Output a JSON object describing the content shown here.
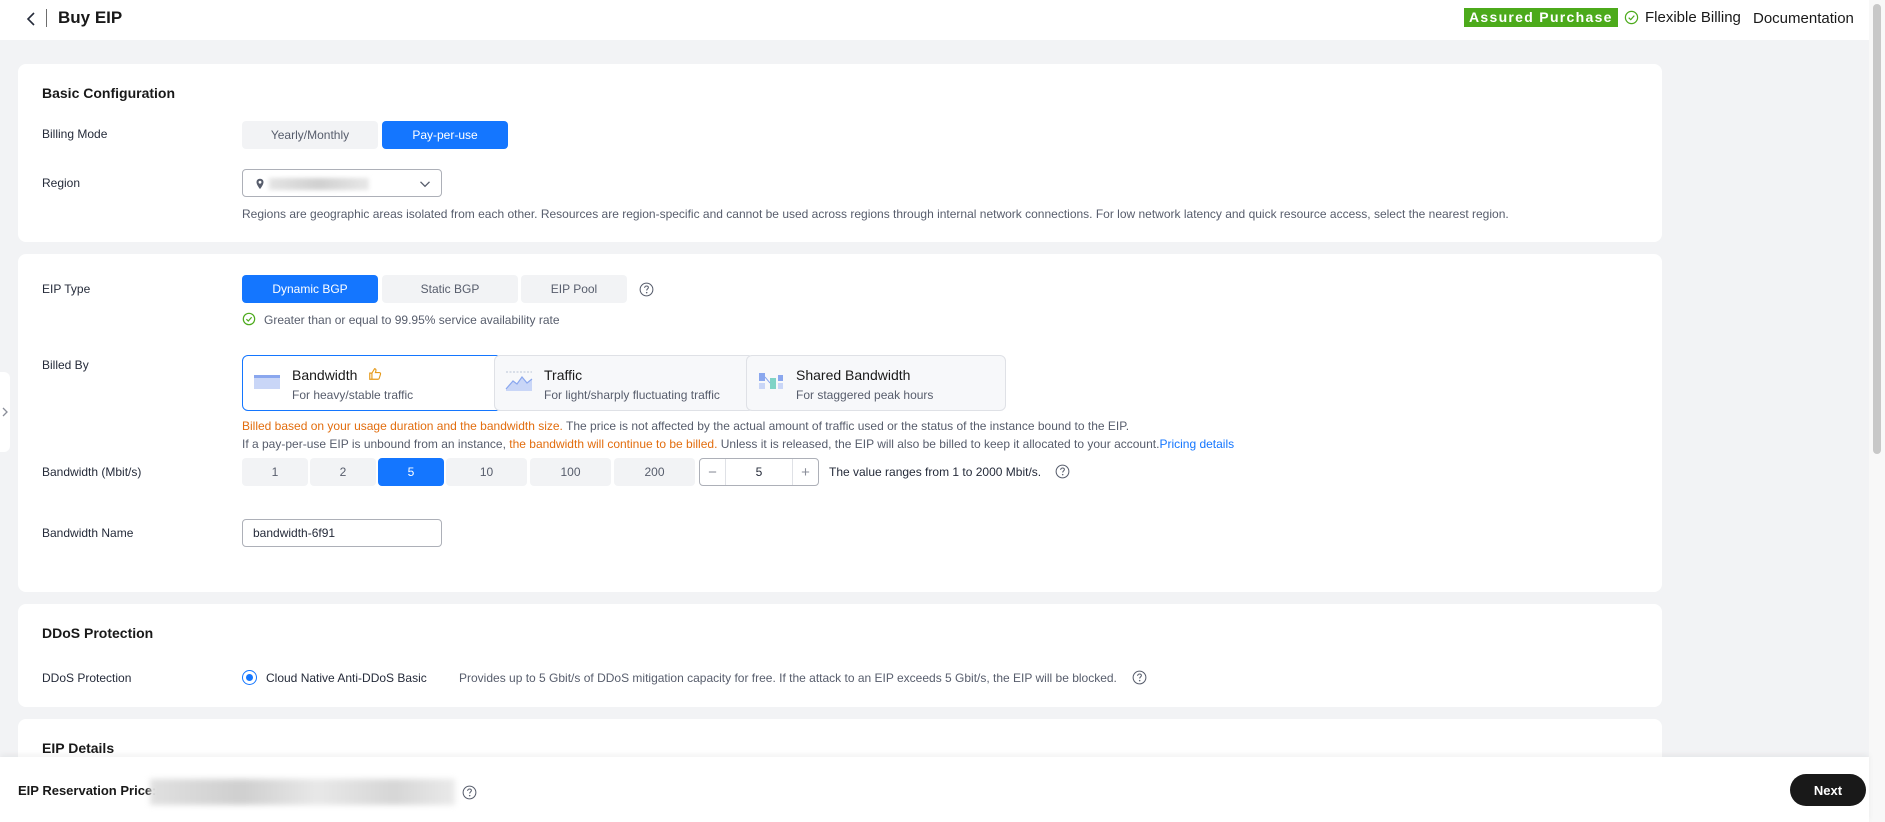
{
  "header": {
    "title": "Buy EIP",
    "assured_badge": "Assured Purchase",
    "flexible_billing": "Flexible Billing",
    "documentation": "Documentation"
  },
  "basic": {
    "title": "Basic Configuration",
    "billing_mode_label": "Billing Mode",
    "billing_modes": [
      "Yearly/Monthly",
      "Pay-per-use"
    ],
    "billing_mode_selected": "Pay-per-use",
    "region_label": "Region",
    "region_hint": "Regions are geographic areas isolated from each other. Resources are region-specific and cannot be used across regions through internal network connections. For low network latency and quick resource access, select the nearest region."
  },
  "eip": {
    "type_label": "EIP Type",
    "types": [
      "Dynamic BGP",
      "Static BGP",
      "EIP Pool"
    ],
    "type_selected": "Dynamic BGP",
    "availability_note": "Greater than or equal to 99.95% service availability rate",
    "billed_by_label": "Billed By",
    "billed_by_options": [
      {
        "title": "Bandwidth",
        "subtitle": "For heavy/stable traffic",
        "icon": "bandwidth-icon"
      },
      {
        "title": "Traffic",
        "subtitle": "For light/sharply fluctuating traffic",
        "icon": "traffic-icon"
      },
      {
        "title": "Shared Bandwidth",
        "subtitle": "For staggered peak hours",
        "icon": "shared-bandwidth-icon"
      }
    ],
    "billed_by_selected": "Bandwidth",
    "note_line1_orange": "Billed based on your usage duration and the bandwidth size.",
    "note_line1_rest": " The price is not affected by the actual amount of traffic used or the status of the instance bound to the EIP.",
    "note_line2_start": "If a pay-per-use EIP is unbound from an instance, ",
    "note_line2_orange": "the bandwidth will continue to be billed.",
    "note_line2_rest": " Unless it is released, the EIP will also be billed to keep it allocated to your account.",
    "pricing_link": "Pricing details",
    "bandwidth_label": "Bandwidth (Mbit/s)",
    "bandwidth_options": [
      "1",
      "2",
      "5",
      "10",
      "100",
      "200"
    ],
    "bandwidth_selected": "5",
    "bandwidth_value": "5",
    "bandwidth_range_hint": "The value ranges from 1 to 2000 Mbit/s.",
    "bandwidth_name_label": "Bandwidth Name",
    "bandwidth_name_value": "bandwidth-6f91"
  },
  "ddos": {
    "title": "DDoS Protection",
    "label": "DDoS Protection",
    "option": "Cloud Native Anti-DDoS Basic",
    "description": "Provides up to 5 Gbit/s of DDoS mitigation capacity for free. If the attack to an EIP exceeds 5 Gbit/s, the EIP will be blocked."
  },
  "details": {
    "title": "EIP Details"
  },
  "footer": {
    "price_label": "EIP Reservation Price:",
    "next": "Next"
  },
  "colors": {
    "accent": "#1476ff",
    "assured": "#4caa1b",
    "warning": "#e26d0e",
    "success": "#4caa1b"
  }
}
